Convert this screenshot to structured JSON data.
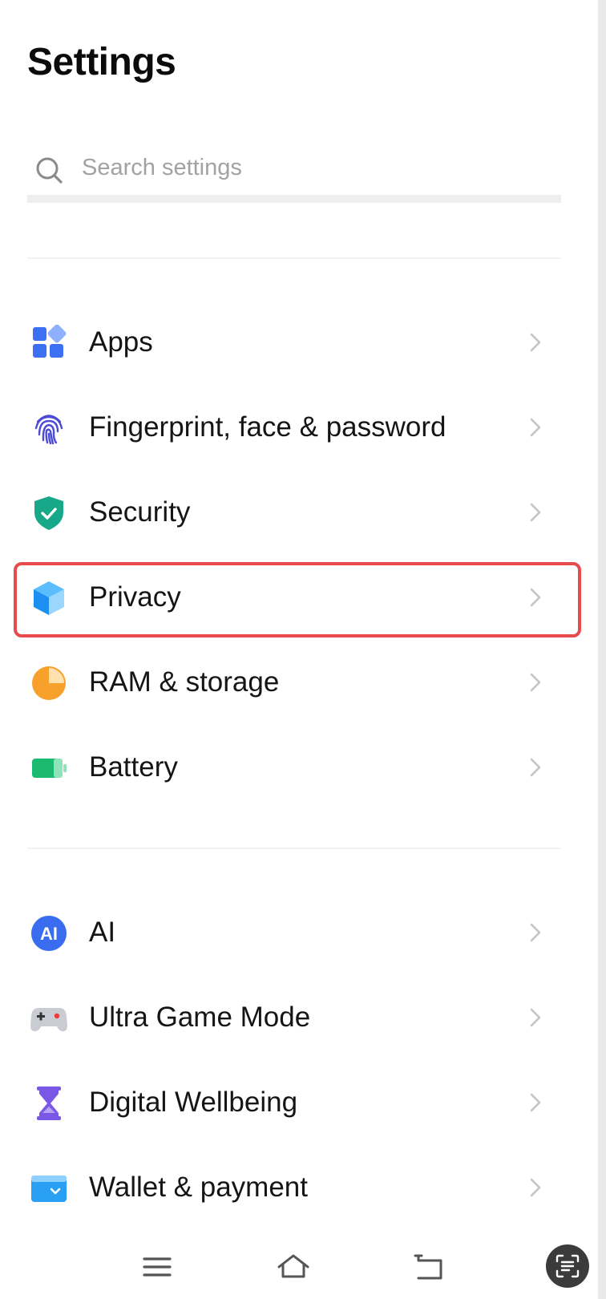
{
  "header": {
    "title": "Settings"
  },
  "search": {
    "placeholder": "Search settings",
    "icon": "search-icon"
  },
  "group1": [
    {
      "label": "Apps",
      "icon": "apps-icon"
    },
    {
      "label": "Fingerprint, face & password",
      "icon": "fingerprint-icon"
    },
    {
      "label": "Security",
      "icon": "shield-icon"
    },
    {
      "label": "Privacy",
      "icon": "privacy-cube-icon",
      "highlighted": true
    },
    {
      "label": "RAM & storage",
      "icon": "pie-chart-icon"
    },
    {
      "label": "Battery",
      "icon": "battery-icon"
    }
  ],
  "group2": [
    {
      "label": "AI",
      "icon": "ai-icon"
    },
    {
      "label": "Ultra Game Mode",
      "icon": "gamepad-icon"
    },
    {
      "label": "Digital Wellbeing",
      "icon": "hourglass-icon"
    },
    {
      "label": "Wallet & payment",
      "icon": "wallet-icon"
    }
  ],
  "navbar": {
    "buttons": [
      "menu-icon",
      "home-icon",
      "back-icon",
      "screenshot-icon"
    ]
  },
  "colors": {
    "highlight_border": "#e84b4b",
    "apps": "#3d6ff2",
    "fingerprint": "#4b4bd6",
    "security": "#17a88a",
    "privacy": "#2aa0f5",
    "storage": "#f7a02b",
    "battery": "#1cba6e",
    "ai": "#3a6cf0",
    "wellbeing": "#7b57e6",
    "wallet": "#2aa0f5"
  }
}
